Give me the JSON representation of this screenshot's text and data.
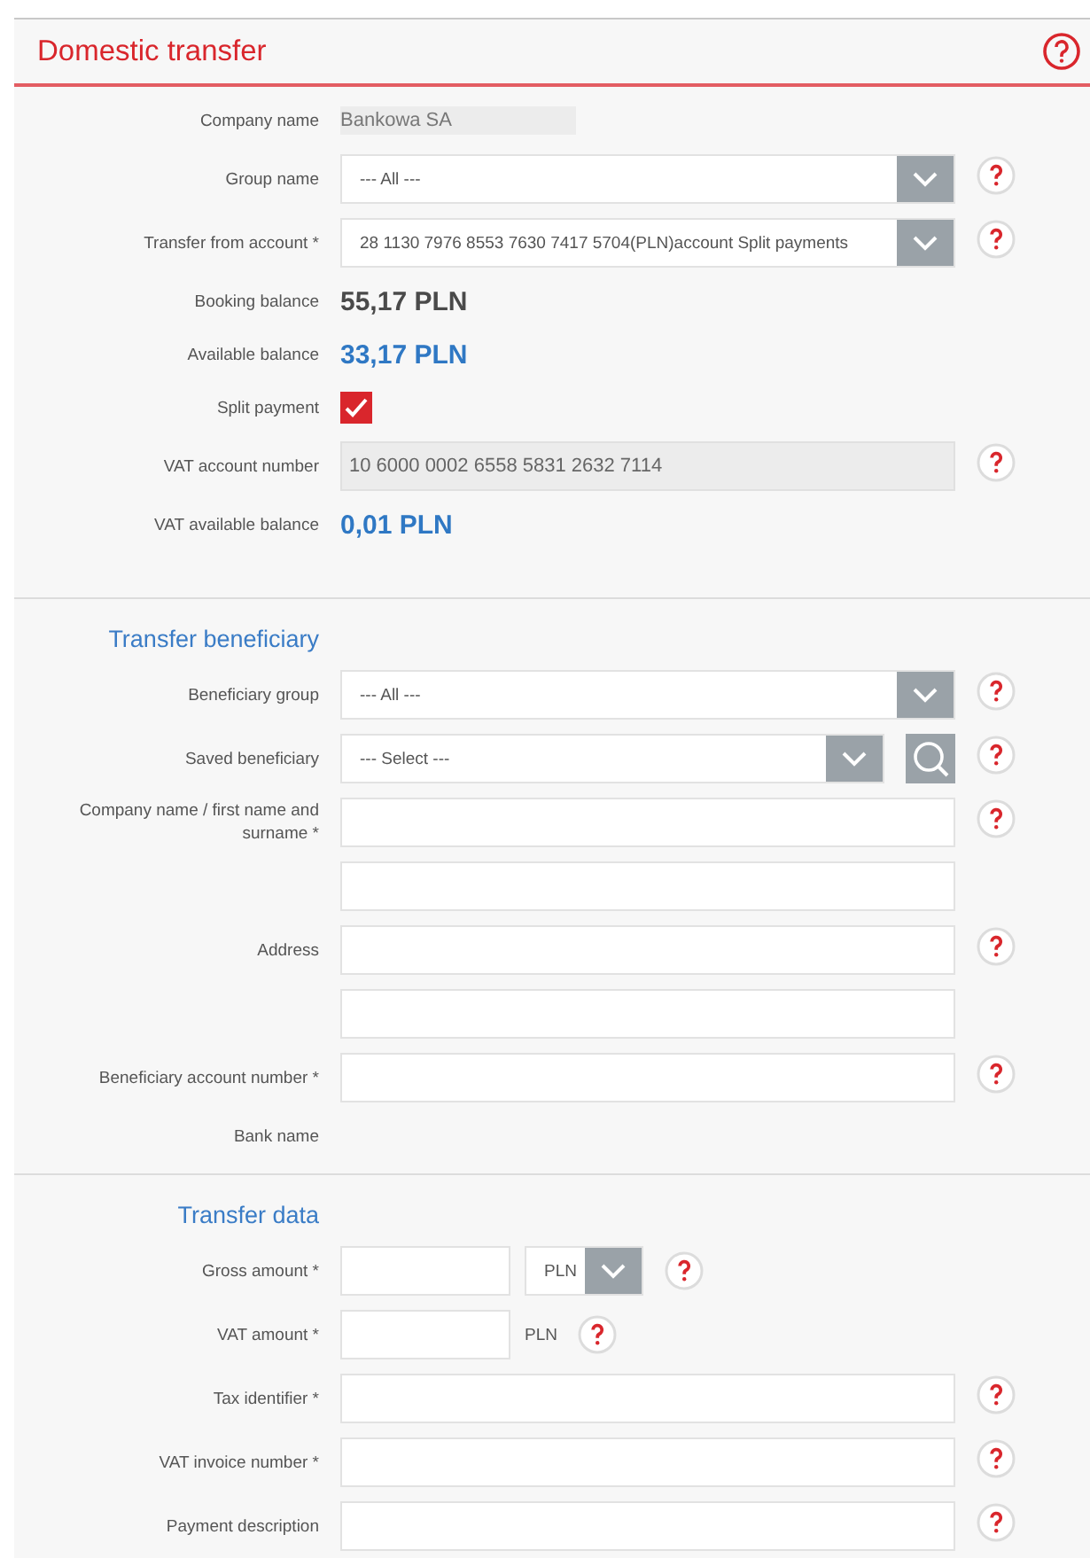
{
  "title": "Domestic transfer",
  "title_help": true,
  "sections": [
    {
      "kind": "main",
      "rows": [
        {
          "kind": "static",
          "label": "Company name",
          "value": "Bankowa SA",
          "help": false
        },
        {
          "kind": "select",
          "label": "Group name",
          "value": "--- All ---",
          "help": true
        },
        {
          "kind": "select",
          "label": "Transfer from account *",
          "value": "28 1130 7976 8553 7630 7417 5704(PLN)account Split payments",
          "help": true
        },
        {
          "kind": "balance",
          "label": "Booking balance",
          "value": "55,17 PLN",
          "color": "#4a4a4a",
          "help": false
        },
        {
          "kind": "balance",
          "label": "Available balance",
          "value": "33,17 PLN",
          "color": "#2f78c4",
          "help": false
        },
        {
          "kind": "checkbox",
          "label": "Split payment",
          "checked": true,
          "help": false
        },
        {
          "kind": "readonly",
          "label": "VAT account number",
          "value": "10 6000 0002 6558 5831 2632 7114",
          "help": true
        },
        {
          "kind": "balance",
          "label": "VAT available balance",
          "value": "0,01 PLN",
          "color": "#2f78c4",
          "help": false
        }
      ]
    },
    {
      "kind": "sub",
      "title": "Transfer beneficiary",
      "rows": [
        {
          "kind": "select",
          "label": "Beneficiary group",
          "value": "--- All ---",
          "help": true
        },
        {
          "kind": "select",
          "label": "Saved beneficiary",
          "value": "--- Select ---",
          "search": true,
          "help": true
        },
        {
          "kind": "input",
          "label": "Company name / first name and surname *",
          "help": true
        },
        {
          "kind": "input",
          "help": false
        },
        {
          "kind": "input",
          "label": "Address",
          "help": true
        },
        {
          "kind": "input",
          "help": false
        },
        {
          "kind": "input",
          "label": "Beneficiary account number *",
          "help": true
        },
        {
          "kind": "label",
          "label": "Bank name",
          "help": false
        }
      ]
    },
    {
      "kind": "sub",
      "title": "Transfer data",
      "rows": [
        {
          "kind": "amount-select",
          "label": "Gross amount *",
          "currency": "PLN",
          "help": true
        },
        {
          "kind": "amount",
          "label": "VAT amount *",
          "currency": "PLN",
          "help": true
        },
        {
          "kind": "input",
          "label": "Tax identifier *",
          "help": true
        },
        {
          "kind": "input",
          "label": "VAT invoice number *",
          "help": true
        },
        {
          "kind": "input",
          "label": "Payment description",
          "help": true
        }
      ]
    }
  ]
}
